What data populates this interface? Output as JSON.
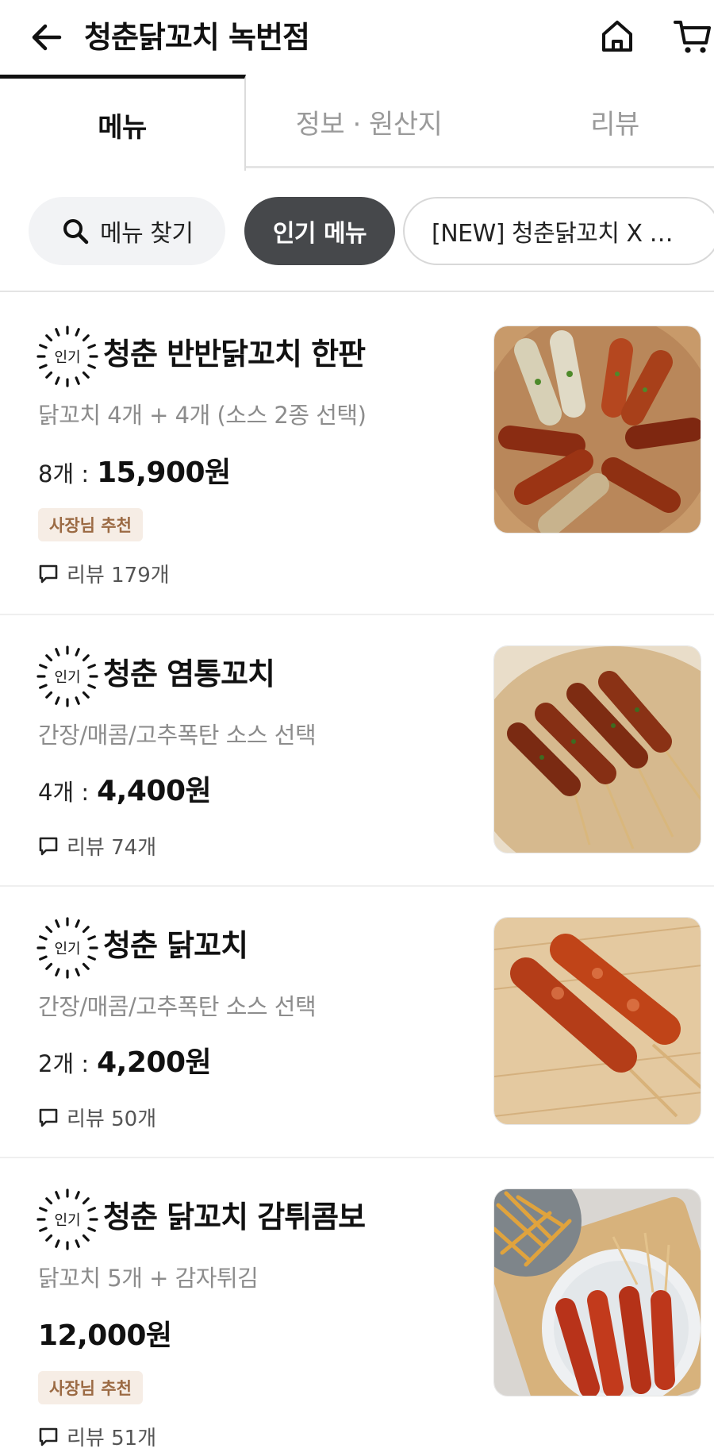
{
  "header": {
    "title": "청춘닭꼬치 녹번점",
    "back_icon": "arrow-left-icon",
    "home_icon": "home-icon",
    "cart_icon": "cart-icon"
  },
  "tabs": [
    {
      "label": "메뉴",
      "active": true
    },
    {
      "label": "정보 · 원산지",
      "active": false
    },
    {
      "label": "리뷰",
      "active": false
    }
  ],
  "chips": {
    "search": {
      "label": "메뉴 찾기",
      "icon": "search-icon"
    },
    "popular": {
      "label": "인기 메뉴",
      "selected": true
    },
    "new": {
      "label": "[NEW] 청춘닭꼬치 X …"
    }
  },
  "popular_badge_text": "인기",
  "menu_items": [
    {
      "name": "청춘 반반닭꼬치 한판",
      "description": "닭꼬치 4개 + 4개 (소스 2종 선택)",
      "quantity": "8개 :",
      "price": "15,900원",
      "owner_badge": "사장님 추천",
      "review": "리뷰 179개"
    },
    {
      "name": "청춘 염통꼬치",
      "description": "간장/매콤/고추폭탄 소스 선택",
      "quantity": "4개 :",
      "price": "4,400원",
      "owner_badge": "",
      "review": "리뷰 74개"
    },
    {
      "name": "청춘 닭꼬치",
      "description": "간장/매콤/고추폭탄 소스 선택",
      "quantity": "2개 :",
      "price": "4,200원",
      "owner_badge": "",
      "review": "리뷰 50개"
    },
    {
      "name": "청춘 닭꼬치 감튀콤보",
      "description": "닭꼬치 5개 + 감자튀김",
      "quantity": "",
      "price": "12,000원",
      "owner_badge": "사장님 추천",
      "review": "리뷰 51개"
    }
  ],
  "colors": {
    "chip_selected_bg": "#46484b",
    "owner_badge_bg": "#f6ede5",
    "owner_badge_text": "#9b6a43",
    "tab_active_border": "#111111"
  }
}
